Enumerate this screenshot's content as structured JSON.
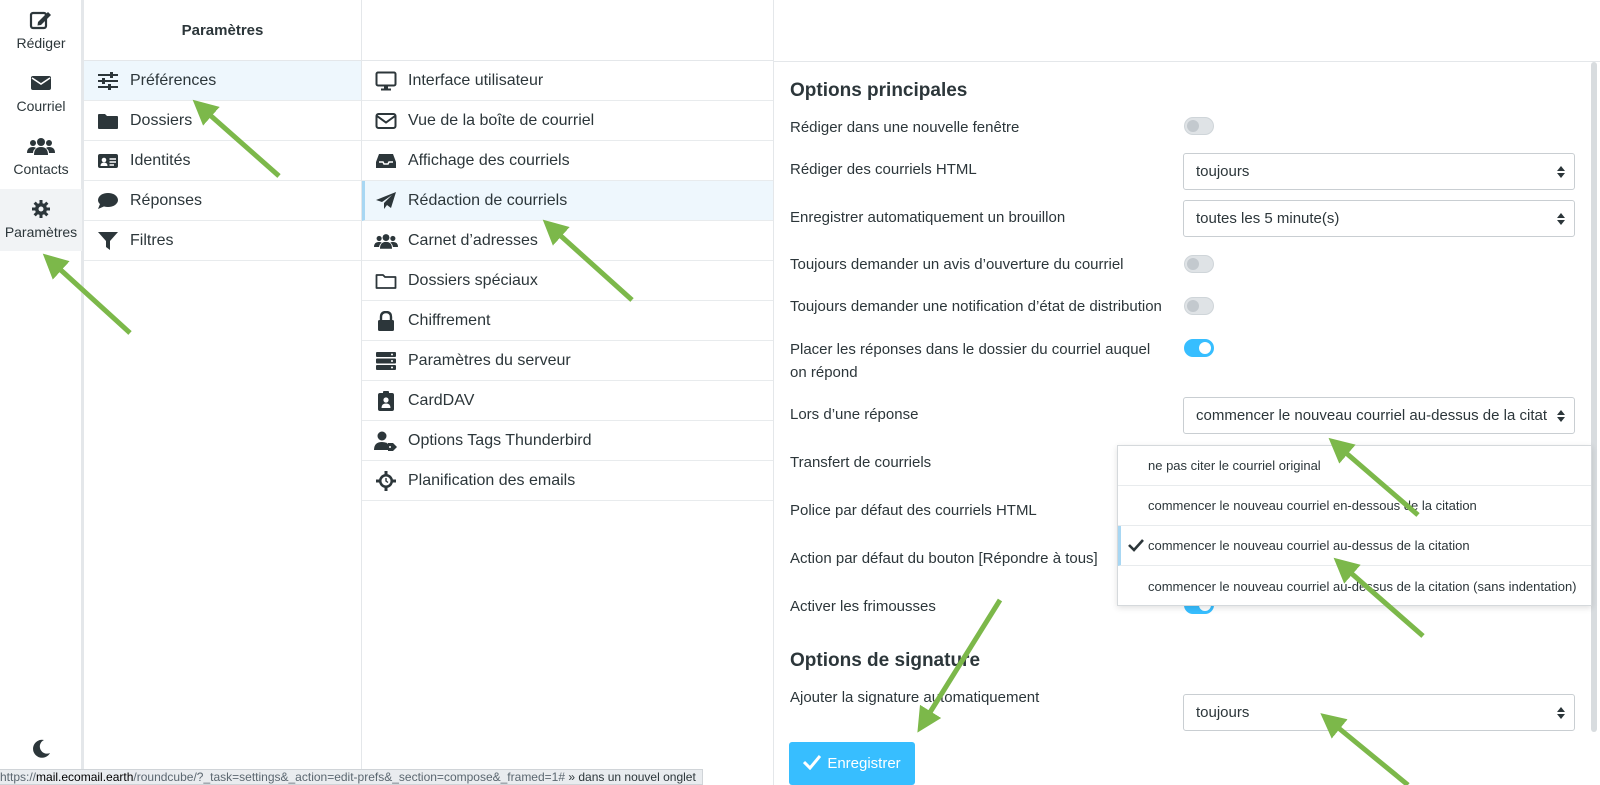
{
  "taskbar": {
    "compose": "Rédiger",
    "mail": "Courriel",
    "contacts": "Contacts",
    "settings": "Paramètres"
  },
  "settings_panel": {
    "title": "Paramètres",
    "items": [
      "Préférences",
      "Dossiers",
      "Identités",
      "Réponses",
      "Filtres"
    ]
  },
  "sections_panel": {
    "items": [
      "Interface utilisateur",
      "Vue de la boîte de courriel",
      "Affichage des courriels",
      "Rédaction de courriels",
      "Carnet d’adresses",
      "Dossiers spéciaux",
      "Chiffrement",
      "Paramètres du serveur",
      "CardDAV",
      "Options Tags Thunderbird",
      "Planification des emails"
    ]
  },
  "main_options": {
    "title": "Options principales",
    "rows": [
      "Rédiger dans une nouvelle fenêtre",
      "Rédiger des courriels HTML",
      "Enregistrer automatiquement un brouillon",
      "Toujours demander un avis d’ouverture du courriel",
      "Toujours demander une notification d’état de distribution",
      "Placer les réponses dans le dossier du courriel auquel on répond",
      "Lors d’une réponse",
      "Transfert de courriels",
      "Police par défaut des courriels HTML",
      "Action par défaut du bouton [Répondre à tous]",
      "Activer les frimousses"
    ],
    "html_compose_value": "toujours",
    "draft_autosave_value": "toutes les 5 minute(s)",
    "reply_mode_value": "commencer le nouveau courriel au-dessus de la citation",
    "toggles": {
      "new_window": false,
      "read_receipt": false,
      "delivery_notification": false,
      "reply_same_folder": true,
      "emoticons": true
    }
  },
  "reply_dropdown": {
    "options": [
      "ne pas citer le courriel original",
      "commencer le nouveau courriel en-dessous de la citation",
      "commencer le nouveau courriel au-dessus de la citation",
      "commencer le nouveau courriel au-dessus de la citation (sans indentation)"
    ],
    "selected_index": 2
  },
  "signature_options": {
    "title": "Options de signature",
    "auto_signature_label": "Ajouter la signature automatiquement",
    "auto_signature_value": "toujours"
  },
  "save_button": "Enregistrer",
  "status_bar": {
    "url_prefix": "https://",
    "host": "mail.ecomail.earth",
    "path": "/roundcube/?_task=settings&_action=edit-prefs&_section=compose&_framed=1#",
    "suffix": " » dans un nouvel onglet"
  },
  "colors": {
    "accent": "#37beff",
    "annotation_arrow": "#7cb84a",
    "selected_bg": "#eef7fd"
  }
}
